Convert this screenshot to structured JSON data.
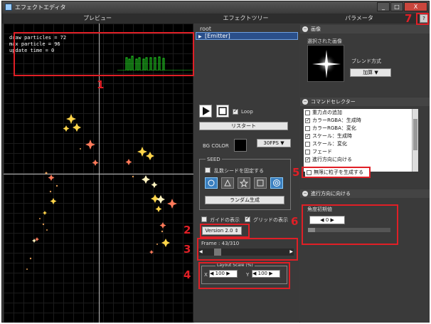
{
  "window": {
    "title": "エフェクトエディタ",
    "controls": {
      "minimize": "_",
      "maximize": "□",
      "close": "X"
    },
    "help_label": "?"
  },
  "headers": {
    "preview": "プレビュー",
    "tree": "エフェクトツリー",
    "params": "パラメータ"
  },
  "stats": {
    "draw_particles": "draw particles = 72",
    "max_particle": "max particle = 96",
    "update_time": "update time = 0"
  },
  "graph_color": "#22dd22",
  "tree": {
    "root": "root",
    "item": "[Emitter]"
  },
  "playback": {
    "loop_label": "Loop",
    "loop_checked": true,
    "restart_label": "リスタート"
  },
  "bg": {
    "label": "BG COLOR",
    "color": "#000000",
    "fps": "30FPS"
  },
  "seed": {
    "title": "SEED",
    "fix_label": "乱数シードを固定する",
    "fix_checked": false,
    "shapes": [
      "circle",
      "triangle",
      "star",
      "square",
      "target"
    ],
    "random_label": "ランダム生成"
  },
  "display": {
    "guide_label": "ガイドの表示",
    "guide_checked": false,
    "grid_label": "グリッドの表示",
    "grid_checked": true
  },
  "version": "Version 2.0",
  "frame": {
    "label": "Frame : 43/310",
    "current": 43,
    "total": 310
  },
  "layout_scale": {
    "title": "Layout Scale (%)",
    "x_label": "X",
    "x_value": "100",
    "y_label": "Y",
    "y_value": "100"
  },
  "image_section": {
    "title": "画像",
    "selected_label": "選択された画像",
    "blend_label": "ブレンド方式",
    "blend_value": "加算"
  },
  "command_section": {
    "title": "コマンドセレクター",
    "items": [
      {
        "label": "重力点の追加",
        "checked": false
      },
      {
        "label": "カラーRGBA：生成時",
        "checked": true
      },
      {
        "label": "カラーRGBA：変化",
        "checked": false
      },
      {
        "label": "スケール：生成時",
        "checked": true
      },
      {
        "label": "スケール：変化",
        "checked": false
      },
      {
        "label": "フェード",
        "checked": false
      },
      {
        "label": "進行方向に向ける",
        "checked": true
      }
    ],
    "infinite_label": "無限に粒子を生成する",
    "infinite_checked": false
  },
  "direction_section": {
    "title": "進行方向に向ける",
    "angle_label": "角度初期値",
    "angle_value": "0"
  },
  "annotations": [
    "1",
    "2",
    "3",
    "4",
    "5",
    "6",
    "7"
  ],
  "accent_color": "#e01f26"
}
